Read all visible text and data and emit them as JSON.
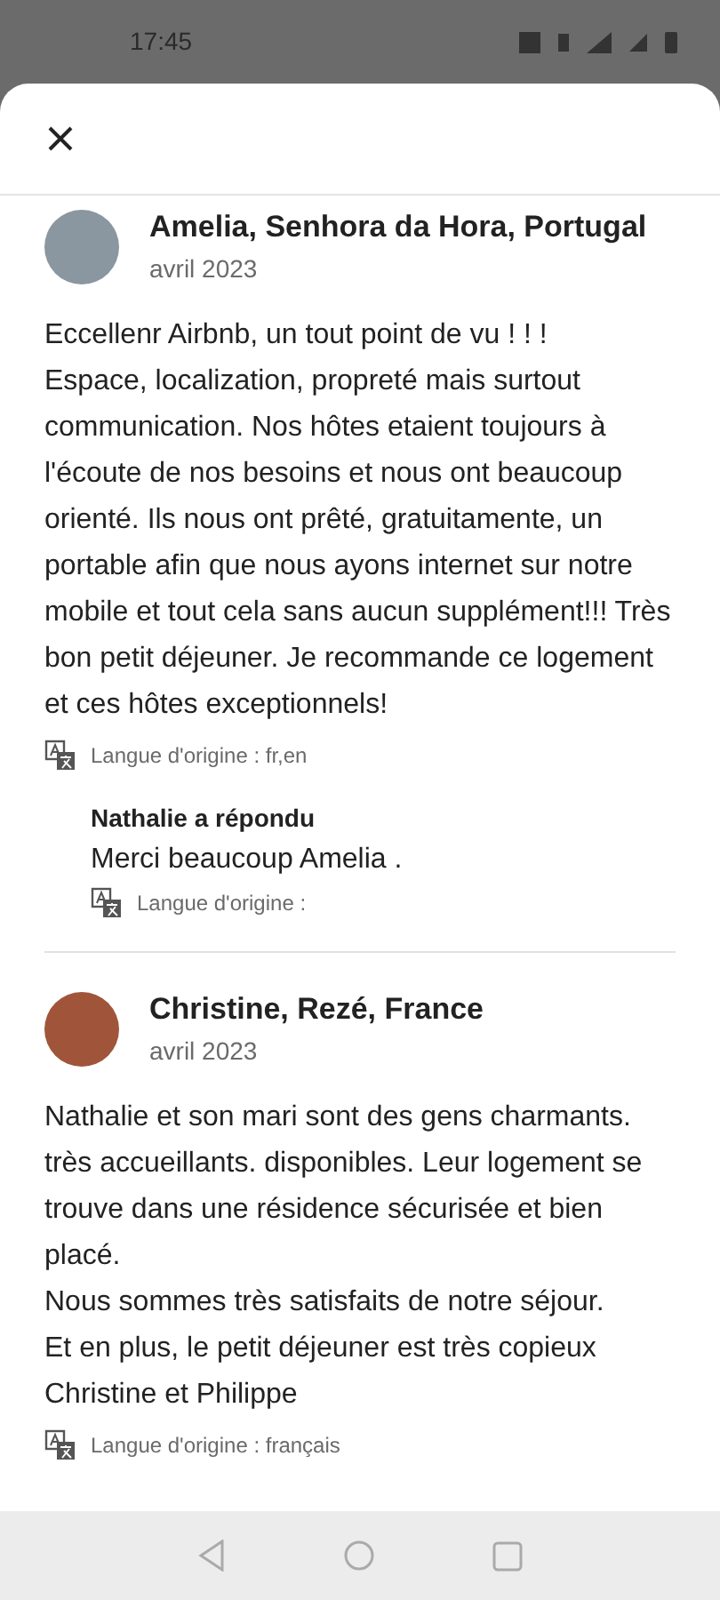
{
  "status_bar": {
    "time": "17:45"
  },
  "reviews": [
    {
      "author": "Amelia, Senhora da Hora, Portugal",
      "date": "avril 2023",
      "text": "Eccellenr Airbnb,  un tout point de vu ! ! !\nEspace, localization, propreté mais surtout communication. Nos hôtes etaient toujours à l'écoute de nos besoins et nous ont beaucoup orienté. Ils nous ont prêté, gratuitamente, un portable afin que nous ayons internet sur notre mobile et tout cela sans aucun supplément!!! Très bon petit déjeuner. Je recommande  ce logement et ces hôtes exceptionnels!",
      "language": "Langue d'origine : fr,en",
      "response": {
        "title": "Nathalie a répondu",
        "text": "Merci beaucoup Amelia .",
        "language": "Langue d'origine :"
      }
    },
    {
      "author": "Christine, Rezé, France",
      "date": "avril 2023",
      "text": "Nathalie et son mari sont des gens charmants. très accueillants. disponibles. Leur logement se trouve dans une résidence sécurisée et bien placé.\nNous sommes très satisfaits de notre séjour.\nEt en plus, le petit déjeuner est très copieux\nChristine et Philippe",
      "language": "Langue d'origine : français"
    }
  ]
}
